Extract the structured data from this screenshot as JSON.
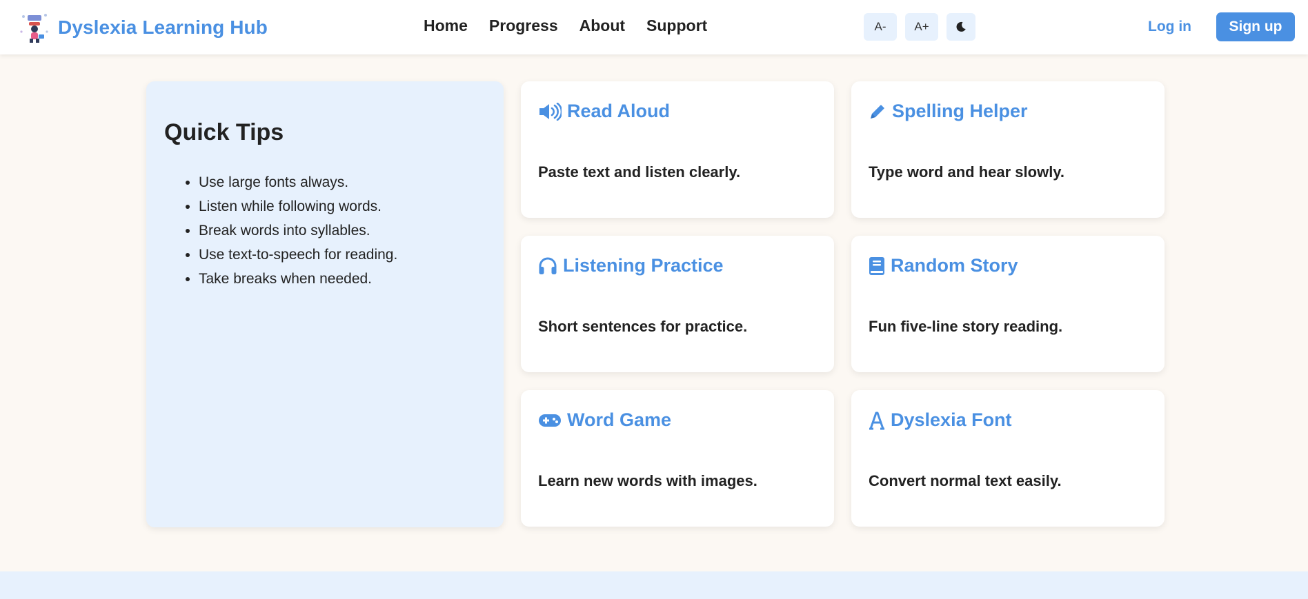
{
  "brand": {
    "title": "Dyslexia Learning Hub"
  },
  "nav": {
    "items": [
      "Home",
      "Progress",
      "About",
      "Support"
    ]
  },
  "tools": {
    "font_decrease": "A-",
    "font_increase": "A+",
    "dark_mode_icon": "moon-icon"
  },
  "auth": {
    "login": "Log in",
    "signup": "Sign up"
  },
  "tips": {
    "title": "Quick Tips",
    "items": [
      "Use large fonts always.",
      "Listen while following words.",
      "Break words into syllables.",
      "Use text-to-speech for reading.",
      "Take breaks when needed."
    ]
  },
  "cards": [
    {
      "title": "Read Aloud",
      "description": "Paste text and listen clearly.",
      "icon": "speaker-icon"
    },
    {
      "title": "Spelling Helper",
      "description": "Type word and hear slowly.",
      "icon": "pencil-icon"
    },
    {
      "title": "Listening Practice",
      "description": "Short sentences for practice.",
      "icon": "headphones-icon"
    },
    {
      "title": "Random Story",
      "description": "Fun five-line story reading.",
      "icon": "book-icon"
    },
    {
      "title": "Word Game",
      "description": "Learn new words with images.",
      "icon": "gamepad-icon"
    },
    {
      "title": "Dyslexia Font",
      "description": "Convert normal text easily.",
      "icon": "font-icon"
    }
  ],
  "colors": {
    "accent": "#4a90e2",
    "background": "#fcf8f3",
    "panel": "#e7f1fd"
  }
}
